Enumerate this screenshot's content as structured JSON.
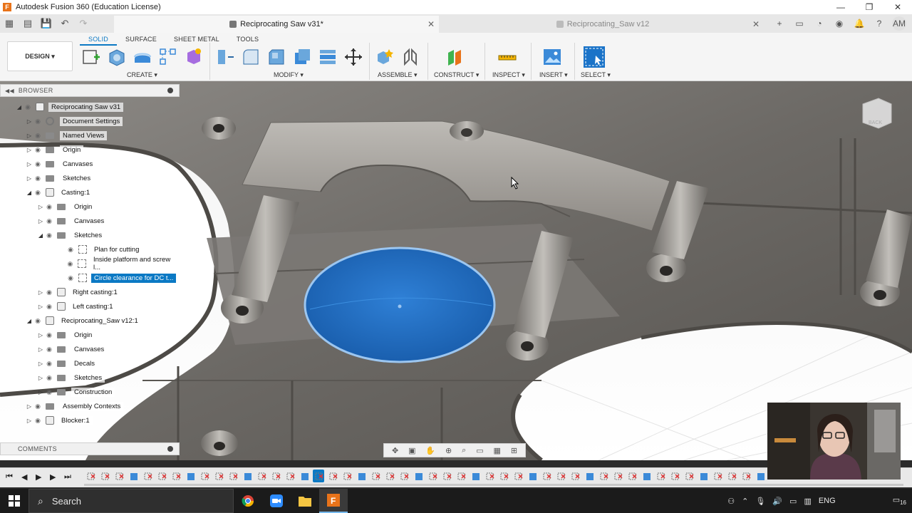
{
  "window": {
    "title": "Autodesk Fusion 360 (Education License)",
    "app_icon_letter": "F",
    "minimize": "—",
    "maximize": "❐",
    "close": "✕"
  },
  "tabs": {
    "active": {
      "label": "Reciprocating Saw v31*"
    },
    "inactive": {
      "label": "Reciprocating_Saw v12"
    },
    "close_glyph": "✕",
    "new_tab_glyph": "+"
  },
  "account": {
    "initials": "AM"
  },
  "ribbon": {
    "tabs": [
      {
        "label": "SOLID",
        "active": true
      },
      {
        "label": "SURFACE",
        "active": false
      },
      {
        "label": "SHEET METAL",
        "active": false
      },
      {
        "label": "TOOLS",
        "active": false
      }
    ],
    "workspace": "DESIGN ▾",
    "groups": {
      "create": "CREATE ▾",
      "modify": "MODIFY ▾",
      "assemble": "ASSEMBLE ▾",
      "construct": "CONSTRUCT ▾",
      "inspect": "INSPECT ▾",
      "insert": "INSERT ▾",
      "select": "SELECT ▾"
    }
  },
  "browser": {
    "title": "BROWSER",
    "items": [
      {
        "label": "Reciprocating Saw v31",
        "depth": 0,
        "expanded": true,
        "kind": "root"
      },
      {
        "label": "Document Settings",
        "depth": 1,
        "kind": "settings"
      },
      {
        "label": "Named Views",
        "depth": 1,
        "kind": "folder"
      },
      {
        "label": "Origin",
        "depth": 1,
        "kind": "folder"
      },
      {
        "label": "Canvases",
        "depth": 1,
        "kind": "folder"
      },
      {
        "label": "Sketches",
        "depth": 1,
        "kind": "folder"
      },
      {
        "label": "Casting:1",
        "depth": 1,
        "kind": "component",
        "expanded": true
      },
      {
        "label": "Origin",
        "depth": 2,
        "kind": "folder"
      },
      {
        "label": "Canvases",
        "depth": 2,
        "kind": "folder"
      },
      {
        "label": "Sketches",
        "depth": 2,
        "kind": "folder",
        "expanded": true
      },
      {
        "label": "Plan for cutting",
        "depth": 3,
        "kind": "sketch"
      },
      {
        "label": "Inside platform and screw l...",
        "depth": 3,
        "kind": "sketch"
      },
      {
        "label": "Circle clearance for DC t...",
        "depth": 3,
        "kind": "sketch",
        "selected": true
      },
      {
        "label": "Right casting:1",
        "depth": 2,
        "kind": "component"
      },
      {
        "label": "Left casting:1",
        "depth": 2,
        "kind": "component"
      },
      {
        "label": "Reciprocating_Saw v12:1",
        "depth": 1,
        "kind": "link",
        "expanded": true
      },
      {
        "label": "Origin",
        "depth": 2,
        "kind": "folder"
      },
      {
        "label": "Canvases",
        "depth": 2,
        "kind": "folder"
      },
      {
        "label": "Decals",
        "depth": 2,
        "kind": "folder"
      },
      {
        "label": "Sketches",
        "depth": 2,
        "kind": "folder"
      },
      {
        "label": "Construction",
        "depth": 2,
        "kind": "folder"
      },
      {
        "label": "Assembly Contexts",
        "depth": 1,
        "kind": "folder"
      },
      {
        "label": "Blocker:1",
        "depth": 1,
        "kind": "component"
      }
    ]
  },
  "comments": {
    "title": "COMMENTS"
  },
  "viewcube": {
    "face_label": "BACK"
  },
  "taskbar": {
    "search_placeholder": "Search",
    "language": "ENG",
    "notification_count": "16"
  },
  "colors": {
    "accent": "#0b79c4",
    "selection_fill": "#1f6fc8"
  }
}
